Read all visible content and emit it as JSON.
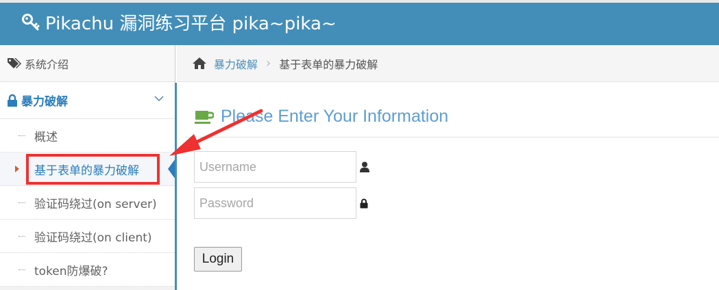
{
  "header": {
    "title": "Pikachu 漏洞练习平台 pika~pika~",
    "icon": "key-icon"
  },
  "sidebar": {
    "intro_label": "系统介绍",
    "category_label": "暴力破解",
    "items": [
      {
        "label": "概述"
      },
      {
        "label": "基于表单的暴力破解"
      },
      {
        "label": "验证码绕过(on server)"
      },
      {
        "label": "验证码绕过(on client)"
      },
      {
        "label": "token防爆破?"
      }
    ]
  },
  "breadcrumb": {
    "link": "暴力破解",
    "separator": "›",
    "current": "基于表单的暴力破解"
  },
  "form": {
    "heading": "Please Enter Your Information",
    "username_placeholder": "Username",
    "password_placeholder": "Password",
    "login_label": "Login"
  },
  "colors": {
    "header_bg": "#438eb9",
    "accent": "#2b7dbc",
    "annotation_red": "#ee3131"
  }
}
